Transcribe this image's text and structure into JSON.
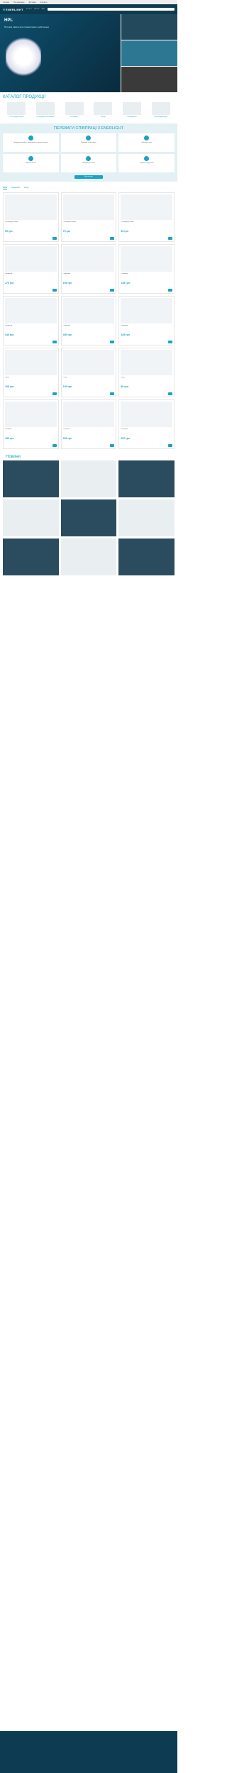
{
  "topbar": {
    "items": [
      "Головна",
      "Про компанію",
      "Доставка",
      "Контакти"
    ]
  },
  "header": {
    "logo": "ENERLIGHT",
    "nav": [
      "Каталог",
      "Новини",
      "Акції"
    ]
  },
  "hero": {
    "title": "HPL",
    "subtitle": "Потужні лампи для промислового освітлення"
  },
  "catalog": {
    "title": "КАТАЛОГ ПРОДУКЦІЇ",
    "items": [
      {
        "label": "Світлодіодні лампи"
      },
      {
        "label": "Світлодіодні світильники"
      },
      {
        "label": "Батарейки"
      },
      {
        "label": "Ліхтарі"
      },
      {
        "label": "Подовжувачі"
      },
      {
        "label": "Електрофурнітура"
      }
    ]
  },
  "advantages": {
    "title": "ПЕРЕВАГИ СПІВПРАЦІ З ENERLIGHT",
    "items": [
      {
        "text": "Продукція надійна, ефективна та довго служить"
      },
      {
        "text": "Широкий асортимент"
      },
      {
        "text": "Доступна ціна"
      },
      {
        "text": "Гарантія якості"
      },
      {
        "text": "Швидка доставка"
      },
      {
        "text": "Сервісна підтримка"
      }
    ],
    "button": "Детальніше"
  },
  "tabs": [
    "Хіти",
    "Новинки",
    "Акції"
  ],
  "products": [
    {
      "name": "Світлодіодна лампа",
      "price": "59 грн"
    },
    {
      "name": "Світлодіодна лампа",
      "price": "75 грн"
    },
    {
      "name": "Світлодіодна лампа",
      "price": "89 грн"
    },
    {
      "name": "Світильник",
      "price": "175 грн"
    },
    {
      "name": "Світильник",
      "price": "199 грн"
    },
    {
      "name": "Світильник",
      "price": "149 грн"
    },
    {
      "name": "Світильник",
      "price": "349 грн"
    },
    {
      "name": "Світильник",
      "price": "400 грн"
    },
    {
      "name": "Світильник",
      "price": "325 грн"
    },
    {
      "name": "Лампа",
      "price": "105 грн"
    },
    {
      "name": "Лампа",
      "price": "109 грн"
    },
    {
      "name": "Лампа",
      "price": "89 грн"
    },
    {
      "name": "Батарейка",
      "price": "159 грн"
    },
    {
      "name": "Батарейка",
      "price": "339 грн"
    },
    {
      "name": "Батарейка",
      "price": "257 грн"
    }
  ],
  "news": {
    "title": "Новини"
  }
}
